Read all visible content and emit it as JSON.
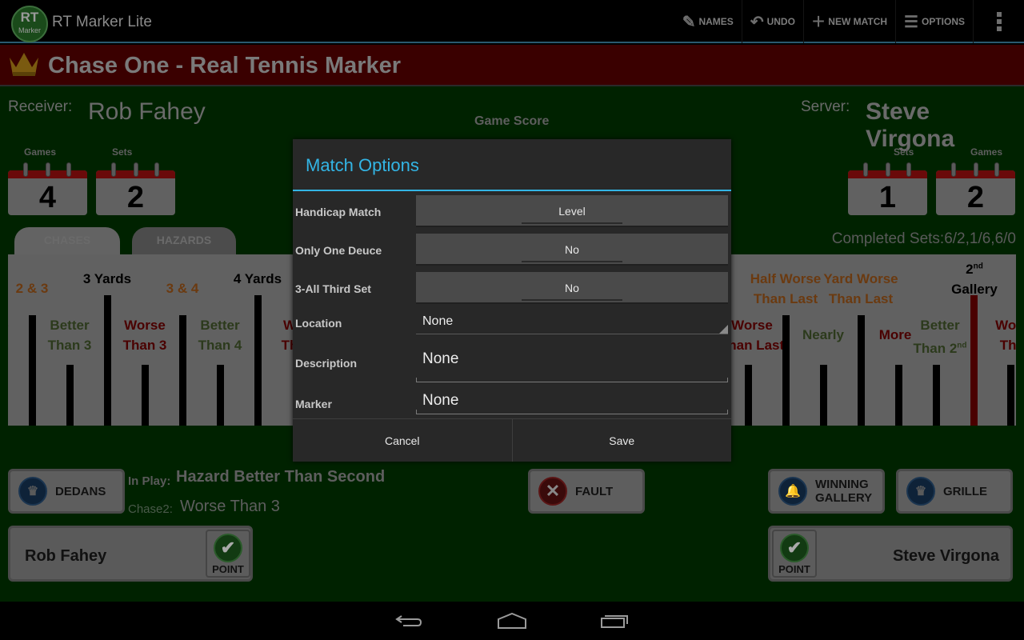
{
  "app": {
    "logo_line1": "RT",
    "logo_line2": "Marker",
    "title": "RT Marker Lite"
  },
  "actionbar": {
    "names": "NAMES",
    "undo": "UNDO",
    "new_match": "NEW MATCH",
    "options": "OPTIONS"
  },
  "banner": {
    "title": "Chase One - Real Tennis Marker"
  },
  "receiver": {
    "label": "Receiver:",
    "name": "Rob Fahey",
    "games_label": "Games",
    "games": "4",
    "sets_label": "Sets",
    "sets": "2"
  },
  "server": {
    "label": "Server:",
    "name": "Steve Virgona",
    "games_label": "Games",
    "games": "2",
    "sets_label": "Sets",
    "sets": "1"
  },
  "game_score_label": "Game Score",
  "tabs": [
    {
      "label": "CHASES"
    },
    {
      "label": "HAZARDS"
    }
  ],
  "completed_sets": "Completed Sets:6/2,1/6,6/0",
  "court": {
    "labels_left": [
      {
        "text1": "2 & 3",
        "text2": "",
        "color": "orange"
      },
      {
        "text1": "3 Yards",
        "text2": "",
        "color": "black"
      },
      {
        "text1": "3 & 4",
        "text2": "",
        "color": "orange"
      },
      {
        "text1": "4 Yards",
        "text2": "",
        "color": "black"
      },
      {
        "text1": "Better",
        "text2": "Than 3",
        "color": "green"
      },
      {
        "text1": "Worse",
        "text2": "Than 3",
        "color": "red"
      },
      {
        "text1": "Better",
        "text2": "Than 4",
        "color": "green"
      }
    ],
    "labels_right": [
      {
        "text1": "Half Worse",
        "text2": "Than Last",
        "color": "orange"
      },
      {
        "text1": "Yard Worse",
        "text2": "Than Last",
        "color": "orange"
      },
      {
        "text1": "Worse",
        "text2": "Than Last",
        "color": "red"
      },
      {
        "text1": "Nearly",
        "text2": "",
        "color": "green"
      },
      {
        "text1": "More",
        "text2": "",
        "color": "red"
      },
      {
        "text1": "Better",
        "text2": "Than 2nd",
        "color": "green"
      },
      {
        "text1": "2nd",
        "text2": "Gallery",
        "color": "black"
      },
      {
        "text1": "Worse",
        "text2": "Than",
        "color": "red"
      }
    ]
  },
  "controls": {
    "dedans": "DEDANS",
    "fault": "FAULT",
    "winning_gallery_1": "WINNING",
    "winning_gallery_2": "GALLERY",
    "grille": "GRILLE",
    "in_play_label": "In Play:",
    "in_play_value": "Hazard Better Than Second",
    "chase2_label": "Chase2:",
    "chase2_value": "Worse Than 3",
    "point_label": "POINT",
    "receiver_point_name": "Rob Fahey",
    "server_point_name": "Steve Virgona"
  },
  "dialog": {
    "title": "Match Options",
    "options": [
      {
        "label": "Handicap Match",
        "value": "Level"
      },
      {
        "label": "Only One Deuce",
        "value": "No"
      },
      {
        "label": "3-All Third Set",
        "value": "No"
      }
    ],
    "location_label": "Location",
    "location_value": "None",
    "description_label": "Description",
    "description_value": "None",
    "marker_label": "Marker",
    "marker_value": "None",
    "cancel": "Cancel",
    "save": "Save"
  }
}
